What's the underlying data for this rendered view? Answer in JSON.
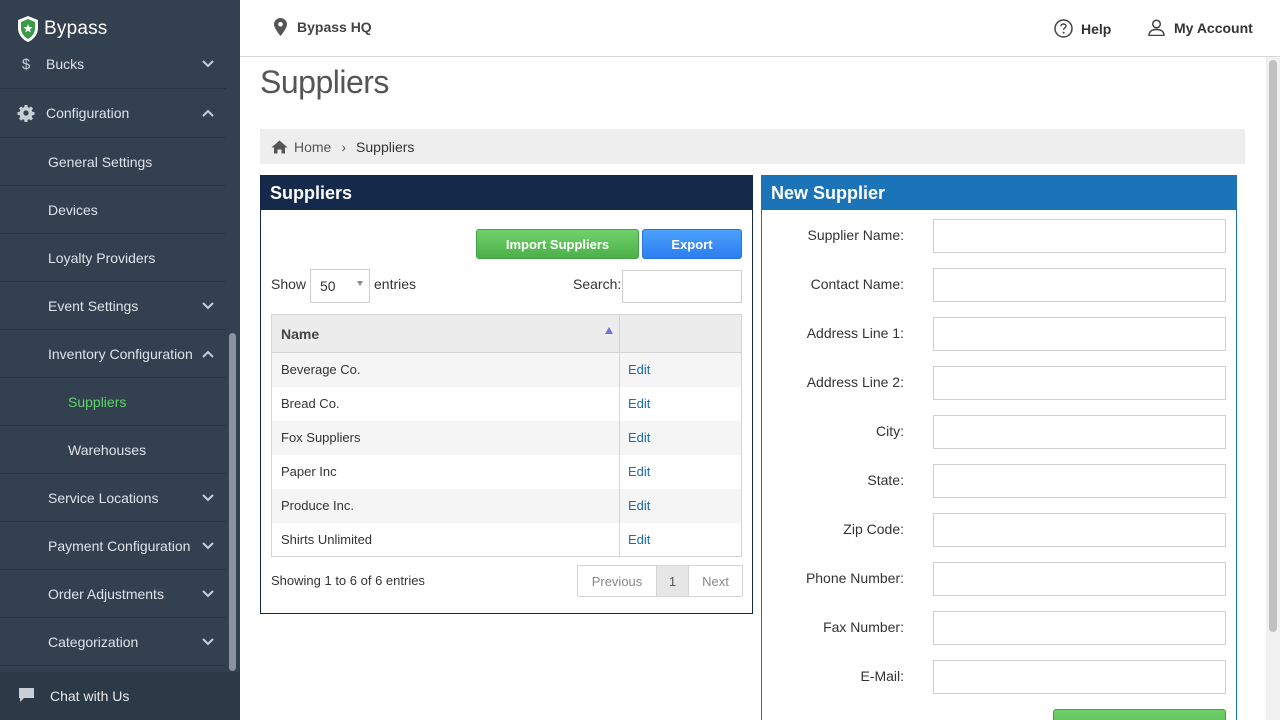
{
  "brand": {
    "name": "Bypass"
  },
  "sidebar": {
    "items": [
      {
        "label": "Bucks",
        "icon": "dollar-icon"
      },
      {
        "label": "Configuration",
        "icon": "gear-icon"
      },
      {
        "label": "General Settings"
      },
      {
        "label": "Devices"
      },
      {
        "label": "Loyalty Providers"
      },
      {
        "label": "Event Settings"
      },
      {
        "label": "Inventory Configuration"
      },
      {
        "label": "Suppliers"
      },
      {
        "label": "Warehouses"
      },
      {
        "label": "Service Locations"
      },
      {
        "label": "Payment Configuration"
      },
      {
        "label": "Order Adjustments"
      },
      {
        "label": "Categorization"
      }
    ],
    "chat_label": "Chat with Us",
    "active_color": "#62d36a"
  },
  "header": {
    "location": "Bypass HQ",
    "help": "Help",
    "account": "My Account"
  },
  "page": {
    "title": "Suppliers",
    "breadcrumb": {
      "home": "Home",
      "current": "Suppliers"
    }
  },
  "suppliers_panel": {
    "title": "Suppliers",
    "import_label": "Import Suppliers",
    "export_label": "Export",
    "show_label": "Show",
    "entries_value": "50",
    "entries_label": "entries",
    "search_label": "Search:",
    "columns": [
      "Name",
      ""
    ],
    "rows": [
      {
        "name": "Beverage Co.",
        "action": "Edit"
      },
      {
        "name": "Bread Co.",
        "action": "Edit"
      },
      {
        "name": "Fox Suppliers",
        "action": "Edit"
      },
      {
        "name": "Paper Inc",
        "action": "Edit"
      },
      {
        "name": "Produce Inc.",
        "action": "Edit"
      },
      {
        "name": "Shirts Unlimited",
        "action": "Edit"
      }
    ],
    "info": "Showing 1 to 6 of 6 entries",
    "pagination": {
      "previous": "Previous",
      "page": "1",
      "next": "Next"
    }
  },
  "new_supplier": {
    "title": "New Supplier",
    "fields": [
      {
        "label": "Supplier Name:"
      },
      {
        "label": "Contact Name:"
      },
      {
        "label": "Address Line 1:"
      },
      {
        "label": "Address Line 2:"
      },
      {
        "label": "City:"
      },
      {
        "label": "State:"
      },
      {
        "label": "Zip Code:"
      },
      {
        "label": "Phone Number:"
      },
      {
        "label": "Fax Number:"
      },
      {
        "label": "E-Mail:"
      }
    ]
  },
  "colors": {
    "sidebar_bg": "#324050",
    "suppliers_header": "#152a4b",
    "new_supplier_header": "#1b73b8",
    "import_green": "#4cb04a",
    "export_blue": "#2b7ef0",
    "link_blue": "#1a6bb2"
  }
}
